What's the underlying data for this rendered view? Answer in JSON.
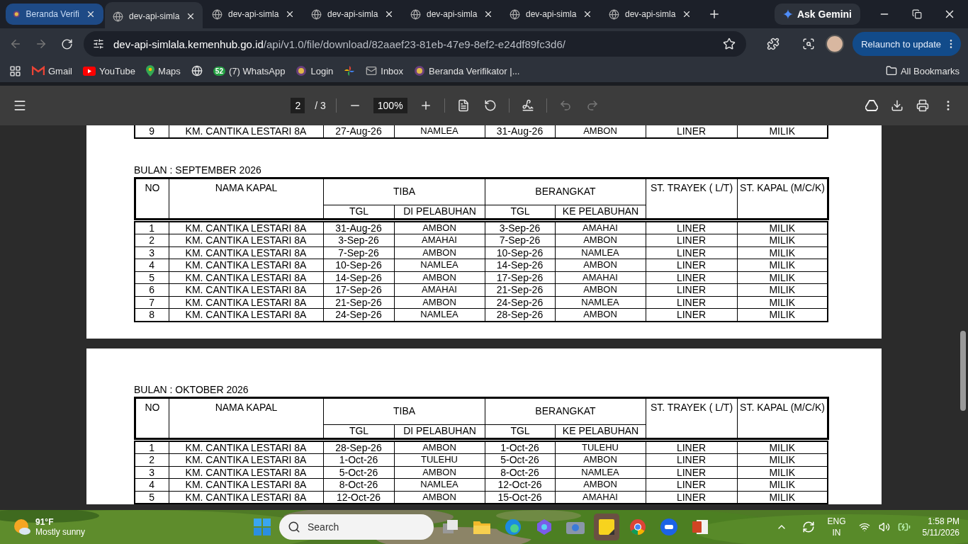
{
  "browser": {
    "tabs": [
      {
        "title": "Beranda Verifi",
        "selected": false,
        "hovered": true
      },
      {
        "title": "dev-api-simla",
        "selected": true,
        "hovered": false
      },
      {
        "title": "dev-api-simla",
        "selected": false,
        "hovered": false
      },
      {
        "title": "dev-api-simla",
        "selected": false,
        "hovered": false
      },
      {
        "title": "dev-api-simla",
        "selected": false,
        "hovered": false
      },
      {
        "title": "dev-api-simla",
        "selected": false,
        "hovered": false
      },
      {
        "title": "dev-api-simla",
        "selected": false,
        "hovered": false
      }
    ],
    "ask_gemini": "Ask Gemini",
    "address": {
      "host": "dev-api-simlala.kemenhub.go.id",
      "path": "/api/v1.0/file/download/82aaef23-81eb-47e9-8ef2-e24df89fc3d6/"
    },
    "relaunch": "Relaunch to update",
    "bookmarks": [
      {
        "kind": "gmail",
        "label": "Gmail"
      },
      {
        "kind": "youtube",
        "label": "YouTube"
      },
      {
        "kind": "maps",
        "label": "Maps"
      },
      {
        "kind": "globe"
      },
      {
        "kind": "whatsapp",
        "badge": "52",
        "label": "(7) WhatsApp"
      },
      {
        "kind": "emblem",
        "label": "Login"
      },
      {
        "kind": "photos"
      },
      {
        "kind": "mail",
        "label": "Inbox"
      },
      {
        "kind": "emblem",
        "label": "Beranda Verifikator |..."
      }
    ],
    "all_bookmarks": "All Bookmarks"
  },
  "pdf_toolbar": {
    "page": "2",
    "total": "/ 3",
    "zoom": "100%"
  },
  "pages": [
    {
      "sections": [
        {
          "rows": [
            [
              "9",
              "KM. CANTIKA LESTARI 8A",
              "27-Aug-26",
              "NAMLEA",
              "31-Aug-26",
              "AMBON",
              "LINER",
              "MILIK"
            ]
          ]
        },
        {
          "title": "BULAN : SEPTEMBER 2026",
          "header": {
            "no": "NO",
            "ship": "NAMA KAPAL",
            "arrive": "TIBA",
            "depart": "BERANGKAT",
            "route": "ST. TRAYEK ( L/T)",
            "status": "ST. KAPAL (M/C/K)",
            "sub": [
              "TGL",
              "DI PELABUHAN",
              "TGL",
              "KE PELABUHAN"
            ]
          },
          "rows": [
            [
              "1",
              "KM. CANTIKA LESTARI 8A",
              "31-Aug-26",
              "AMBON",
              "3-Sep-26",
              "AMAHAI",
              "LINER",
              "MILIK"
            ],
            [
              "2",
              "KM. CANTIKA LESTARI 8A",
              "3-Sep-26",
              "AMAHAI",
              "7-Sep-26",
              "AMBON",
              "LINER",
              "MILIK"
            ],
            [
              "3",
              "KM. CANTIKA LESTARI 8A",
              "7-Sep-26",
              "AMBON",
              "10-Sep-26",
              "NAMLEA",
              "LINER",
              "MILIK"
            ],
            [
              "4",
              "KM. CANTIKA LESTARI 8A",
              "10-Sep-26",
              "NAMLEA",
              "14-Sep-26",
              "AMBON",
              "LINER",
              "MILIK"
            ],
            [
              "5",
              "KM. CANTIKA LESTARI 8A",
              "14-Sep-26",
              "AMBON",
              "17-Sep-26",
              "AMAHAI",
              "LINER",
              "MILIK"
            ],
            [
              "6",
              "KM. CANTIKA LESTARI 8A",
              "17-Sep-26",
              "AMAHAI",
              "21-Sep-26",
              "AMBON",
              "LINER",
              "MILIK"
            ],
            [
              "7",
              "KM. CANTIKA LESTARI 8A",
              "21-Sep-26",
              "AMBON",
              "24-Sep-26",
              "NAMLEA",
              "LINER",
              "MILIK"
            ],
            [
              "8",
              "KM. CANTIKA LESTARI 8A",
              "24-Sep-26",
              "NAMLEA",
              "28-Sep-26",
              "AMBON",
              "LINER",
              "MILIK"
            ]
          ]
        }
      ]
    },
    {
      "sections": [
        {
          "title": "BULAN : OKTOBER 2026",
          "header": {
            "no": "NO",
            "ship": "NAMA KAPAL",
            "arrive": "TIBA",
            "depart": "BERANGKAT",
            "route": "ST. TRAYEK ( L/T)",
            "status": "ST. KAPAL (M/C/K)",
            "sub": [
              "TGL",
              "DI PELABUHAN",
              "TGL",
              "KE PELABUHAN"
            ]
          },
          "rows": [
            [
              "1",
              "KM. CANTIKA LESTARI 8A",
              "28-Sep-26",
              "AMBON",
              "1-Oct-26",
              "TULEHU",
              "LINER",
              "MILIK"
            ],
            [
              "2",
              "KM. CANTIKA LESTARI 8A",
              "1-Oct-26",
              "TULEHU",
              "5-Oct-26",
              "AMBON",
              "LINER",
              "MILIK"
            ],
            [
              "3",
              "KM. CANTIKA LESTARI 8A",
              "5-Oct-26",
              "AMBON",
              "8-Oct-26",
              "NAMLEA",
              "LINER",
              "MILIK"
            ],
            [
              "4",
              "KM. CANTIKA LESTARI 8A",
              "8-Oct-26",
              "NAMLEA",
              "12-Oct-26",
              "AMBON",
              "LINER",
              "MILIK"
            ],
            [
              "5",
              "KM. CANTIKA LESTARI 8A",
              "12-Oct-26",
              "AMBON",
              "15-Oct-26",
              "AMAHAI",
              "LINER",
              "MILIK"
            ]
          ]
        }
      ]
    }
  ],
  "taskbar": {
    "temperature": "91°F",
    "weather": "Mostly sunny",
    "search_placeholder": "Search",
    "language": "ENG",
    "region": "IN",
    "time": "1:58 PM",
    "date": "5/11/2026"
  }
}
